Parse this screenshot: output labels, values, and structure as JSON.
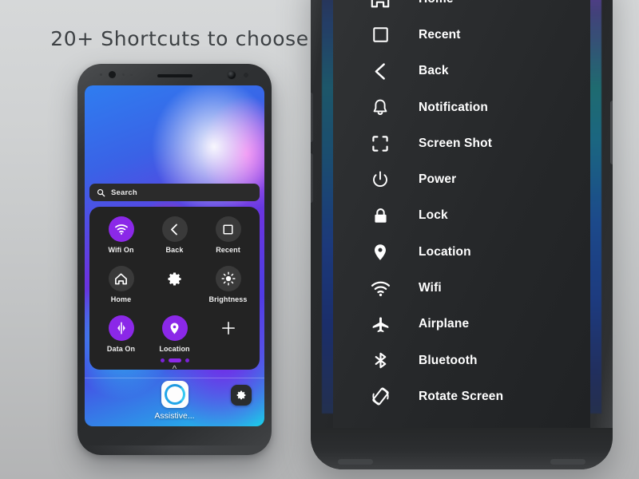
{
  "headline": "20+ Shortcuts to choose",
  "colors": {
    "accent_purple": "#8b28e8",
    "panel_bg": "#232323",
    "search_bg": "#2b2b2b",
    "menu_bg": "#2a2c2e",
    "page_bg_top": "#d6d8d9",
    "page_bg_bottom": "#b3b4b5",
    "app_ring": "#22a6e8"
  },
  "left_phone": {
    "search": {
      "placeholder": "Search",
      "icon": "search-icon"
    },
    "shortcuts": [
      {
        "label": "Wifi On",
        "icon": "wifi-icon",
        "state": "on"
      },
      {
        "label": "Back",
        "icon": "back-icon",
        "state": "off"
      },
      {
        "label": "Recent",
        "icon": "recent-icon",
        "state": "off"
      },
      {
        "label": "Home",
        "icon": "home-icon",
        "state": "off"
      },
      {
        "label": "",
        "icon": "gear-icon",
        "state": "bare"
      },
      {
        "label": "Brightness",
        "icon": "brightness-icon",
        "state": "off"
      },
      {
        "label": "Data On",
        "icon": "data-icon",
        "state": "on"
      },
      {
        "label": "Location",
        "icon": "location-icon",
        "state": "on"
      },
      {
        "label": "",
        "icon": "plus-icon",
        "state": "bare"
      }
    ],
    "pager": {
      "count": 3,
      "active_index": 1
    },
    "dock": {
      "app_label": "Assistive...",
      "app_icon": "assistive-ring-icon",
      "settings_icon": "gear-icon",
      "expand_icon": "chevron-up-icon"
    }
  },
  "right_phone": {
    "menu": [
      {
        "label": "Home",
        "icon": "home-icon"
      },
      {
        "label": "Recent",
        "icon": "recent-icon"
      },
      {
        "label": "Back",
        "icon": "back-icon"
      },
      {
        "label": "Notification",
        "icon": "bell-icon"
      },
      {
        "label": "Screen Shot",
        "icon": "screenshot-icon"
      },
      {
        "label": "Power",
        "icon": "power-icon"
      },
      {
        "label": "Lock",
        "icon": "lock-icon"
      },
      {
        "label": "Location",
        "icon": "location-icon"
      },
      {
        "label": "Wifi",
        "icon": "wifi-icon"
      },
      {
        "label": "Airplane",
        "icon": "airplane-icon"
      },
      {
        "label": "Bluetooth",
        "icon": "bluetooth-icon"
      },
      {
        "label": "Rotate Screen",
        "icon": "rotate-icon"
      }
    ]
  }
}
